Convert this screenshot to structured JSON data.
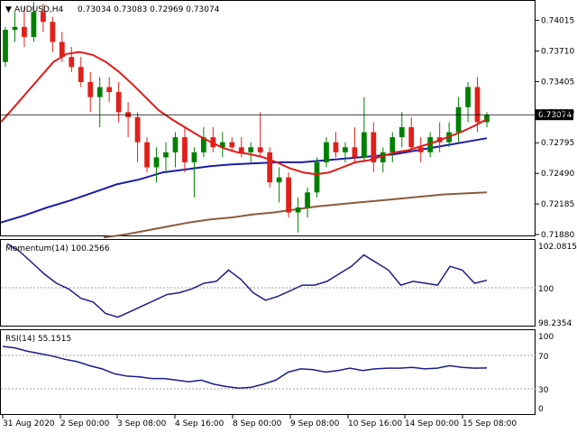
{
  "header": {
    "symbol": "AUDUSD,H4",
    "ohlc": "0.73034 0.73083 0.72969 0.73074"
  },
  "price_panel": {
    "y_ticks": [
      "0.74015",
      "0.73710",
      "0.73405",
      "0.73100",
      "0.72795",
      "0.72490",
      "0.72185",
      "0.71880"
    ],
    "current_price": "0.73074"
  },
  "momentum_panel": {
    "label": "Momentum(14) 100.2566",
    "y_ticks": [
      "102.0815",
      "100",
      "98.2354"
    ]
  },
  "rsi_panel": {
    "label": "RSI(14) 55.1515",
    "y_ticks": [
      "100",
      "70",
      "30",
      "0"
    ]
  },
  "x_axis": {
    "labels": [
      "31 Aug 2020",
      "2 Sep 00:00",
      "3 Sep 08:00",
      "4 Sep 16:00",
      "8 Sep 00:00",
      "9 Sep 08:00",
      "10 Sep 16:00",
      "14 Sep 00:00",
      "15 Sep 08:00"
    ]
  },
  "colors": {
    "bull": "#008000",
    "bear": "#e0201a",
    "ma_fast": "#e01b17",
    "ma_mid": "#1c1caa",
    "ma_slow": "#8b5a3c",
    "indicator": "#1c1c8c"
  },
  "chart_data": [
    {
      "type": "candlestick",
      "title": "AUDUSD,H4",
      "ylim": [
        0.7188,
        0.742
      ],
      "candles": [
        [
          0.736,
          0.7395,
          0.7355,
          0.7392
        ],
        [
          0.7392,
          0.741,
          0.738,
          0.7395
        ],
        [
          0.7395,
          0.7415,
          0.7375,
          0.7385
        ],
        [
          0.7385,
          0.742,
          0.738,
          0.741
        ],
        [
          0.741,
          0.7418,
          0.739,
          0.74
        ],
        [
          0.74,
          0.7405,
          0.737,
          0.738
        ],
        [
          0.738,
          0.739,
          0.736,
          0.7365
        ],
        [
          0.7365,
          0.7375,
          0.735,
          0.7355
        ],
        [
          0.7355,
          0.7365,
          0.7335,
          0.734
        ],
        [
          0.734,
          0.735,
          0.731,
          0.7325
        ],
        [
          0.7325,
          0.7345,
          0.7295,
          0.7335
        ],
        [
          0.7335,
          0.7345,
          0.732,
          0.733
        ],
        [
          0.733,
          0.734,
          0.73,
          0.731
        ],
        [
          0.731,
          0.732,
          0.7285,
          0.7305
        ],
        [
          0.7305,
          0.731,
          0.726,
          0.728
        ],
        [
          0.728,
          0.7285,
          0.725,
          0.7255
        ],
        [
          0.7255,
          0.7275,
          0.724,
          0.7265
        ],
        [
          0.7265,
          0.728,
          0.725,
          0.727
        ],
        [
          0.727,
          0.729,
          0.7255,
          0.7285
        ],
        [
          0.7285,
          0.7295,
          0.725,
          0.726
        ],
        [
          0.726,
          0.7275,
          0.7225,
          0.727
        ],
        [
          0.727,
          0.7295,
          0.7265,
          0.7285
        ],
        [
          0.7285,
          0.7295,
          0.727,
          0.7275
        ],
        [
          0.7275,
          0.729,
          0.7265,
          0.728
        ],
        [
          0.728,
          0.7285,
          0.727,
          0.7275
        ],
        [
          0.7275,
          0.7285,
          0.7265,
          0.727
        ],
        [
          0.727,
          0.728,
          0.726,
          0.7275
        ],
        [
          0.7275,
          0.731,
          0.7265,
          0.727
        ],
        [
          0.727,
          0.7275,
          0.7235,
          0.724
        ],
        [
          0.724,
          0.7255,
          0.722,
          0.7245
        ],
        [
          0.7245,
          0.725,
          0.7205,
          0.721
        ],
        [
          0.721,
          0.7225,
          0.719,
          0.7215
        ],
        [
          0.7215,
          0.7235,
          0.7205,
          0.723
        ],
        [
          0.723,
          0.7265,
          0.7225,
          0.726
        ],
        [
          0.726,
          0.7285,
          0.7255,
          0.728
        ],
        [
          0.728,
          0.729,
          0.7265,
          0.727
        ],
        [
          0.727,
          0.728,
          0.726,
          0.7275
        ],
        [
          0.7275,
          0.7295,
          0.726,
          0.7265
        ],
        [
          0.7265,
          0.7325,
          0.726,
          0.729
        ],
        [
          0.729,
          0.73,
          0.725,
          0.726
        ],
        [
          0.726,
          0.7275,
          0.725,
          0.727
        ],
        [
          0.727,
          0.729,
          0.726,
          0.7285
        ],
        [
          0.7285,
          0.731,
          0.7275,
          0.7295
        ],
        [
          0.7295,
          0.7305,
          0.727,
          0.7275
        ],
        [
          0.7275,
          0.7285,
          0.726,
          0.727
        ],
        [
          0.727,
          0.729,
          0.7265,
          0.7285
        ],
        [
          0.7285,
          0.73,
          0.727,
          0.728
        ],
        [
          0.728,
          0.73,
          0.7275,
          0.729
        ],
        [
          0.729,
          0.7325,
          0.728,
          0.7315
        ],
        [
          0.7315,
          0.734,
          0.73,
          0.7335
        ],
        [
          0.7335,
          0.7345,
          0.729,
          0.73
        ],
        [
          0.73,
          0.731,
          0.7295,
          0.7307
        ]
      ],
      "ma_fast": [
        0.73,
        0.7315,
        0.733,
        0.7345,
        0.736,
        0.7368,
        0.737,
        0.7367,
        0.736,
        0.735,
        0.7338,
        0.7325,
        0.7312,
        0.7303,
        0.7295,
        0.7287,
        0.728,
        0.7274,
        0.727,
        0.7268,
        0.7265,
        0.726,
        0.7254,
        0.725,
        0.7248,
        0.725,
        0.7255,
        0.726,
        0.7262,
        0.7266,
        0.727,
        0.7272,
        0.7276,
        0.728,
        0.7285,
        0.729,
        0.7296,
        0.7303
      ],
      "ma_mid": [
        0.72,
        0.7207,
        0.7215,
        0.7222,
        0.723,
        0.7238,
        0.7243,
        0.725,
        0.7253,
        0.7256,
        0.7258,
        0.7259,
        0.726,
        0.726,
        0.7262,
        0.7264,
        0.7266,
        0.7268,
        0.7272,
        0.7276,
        0.728,
        0.7284
      ],
      "ma_slow": [
        0.7185,
        0.7188,
        0.7192,
        0.7196,
        0.72,
        0.7203,
        0.7205,
        0.7208,
        0.721,
        0.7213,
        0.7216,
        0.7218,
        0.722,
        0.7222,
        0.7224,
        0.7226,
        0.7228,
        0.7229,
        0.723
      ]
    },
    {
      "type": "line",
      "title": "Momentum(14) 100.2566",
      "ylim": [
        97.9,
        102.3
      ],
      "values": [
        102.2,
        101.8,
        101.2,
        100.6,
        100.1,
        99.8,
        99.3,
        99.1,
        98.5,
        98.3,
        98.6,
        98.9,
        99.2,
        99.5,
        99.6,
        99.8,
        100.1,
        100.2,
        100.8,
        100.3,
        99.6,
        99.2,
        99.4,
        99.7,
        100.0,
        100.0,
        100.2,
        100.6,
        101.0,
        101.6,
        101.2,
        100.8,
        100.0,
        100.2,
        100.1,
        100.0,
        101.0,
        100.8,
        100.1,
        100.2566
      ]
    },
    {
      "type": "line",
      "title": "RSI(14) 55.1515",
      "ylim": [
        0,
        100
      ],
      "values": [
        82,
        80,
        76,
        73,
        70,
        66,
        63,
        58,
        54,
        48,
        45,
        44,
        42,
        42,
        40,
        38,
        40,
        35,
        32,
        30,
        31,
        35,
        40,
        50,
        54,
        53,
        50,
        52,
        55,
        52,
        54,
        55,
        55,
        56,
        54,
        55,
        58,
        56,
        55,
        55.1515
      ]
    }
  ]
}
